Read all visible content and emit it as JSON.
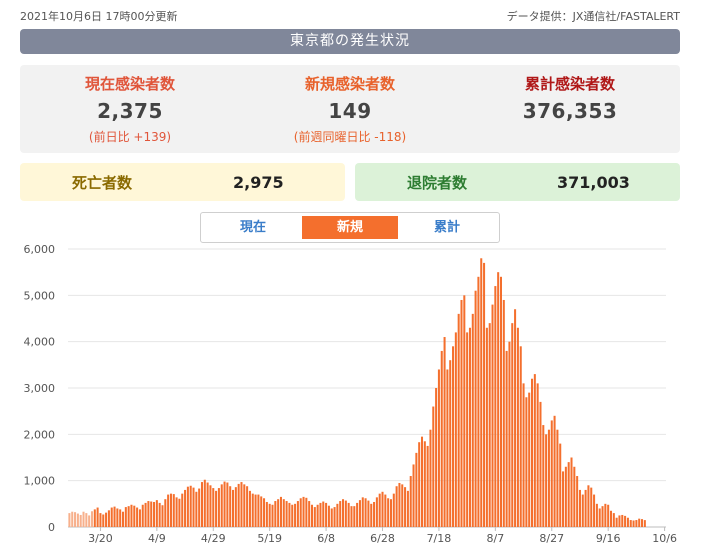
{
  "header": {
    "updated": "2021年10月6日 17時00分更新",
    "source": "データ提供：JX通信社/FASTALERT",
    "title": "東京都の発生状況"
  },
  "stats": {
    "current": {
      "label": "現在感染者数",
      "value": "2,375",
      "diff": "(前日比 +139)"
    },
    "new": {
      "label": "新規感染者数",
      "value": "149",
      "diff": "(前週同曜日比 -118)"
    },
    "total": {
      "label": "累計感染者数",
      "value": "376,353"
    }
  },
  "deaths": {
    "label": "死亡者数",
    "value": "2,975"
  },
  "recovered": {
    "label": "退院者数",
    "value": "371,003"
  },
  "tabs": [
    "現在",
    "新規",
    "累計"
  ],
  "active_tab": 1,
  "colors": {
    "bar": "#f46f2d",
    "bar_faded": "#f7b08c",
    "grid": "#e6e6e6"
  },
  "chart_data": {
    "type": "bar",
    "x_ticks": [
      "3/20",
      "4/9",
      "4/29",
      "5/19",
      "6/8",
      "6/28",
      "7/18",
      "8/7",
      "8/27",
      "9/16",
      "10/6"
    ],
    "y_ticks": [
      0,
      1000,
      2000,
      3000,
      4000,
      5000,
      6000
    ],
    "ylim": [
      0,
      6000
    ],
    "start_date": "2021-03-09",
    "end_date": "2021-10-06",
    "faded_until": "2021-03-17",
    "values": [
      300,
      330,
      320,
      290,
      260,
      330,
      300,
      250,
      340,
      380,
      420,
      300,
      270,
      310,
      360,
      420,
      440,
      400,
      380,
      330,
      430,
      450,
      480,
      460,
      420,
      380,
      480,
      520,
      560,
      550,
      540,
      580,
      520,
      470,
      600,
      700,
      720,
      710,
      640,
      610,
      720,
      800,
      870,
      890,
      850,
      760,
      830,
      970,
      1020,
      960,
      900,
      840,
      780,
      840,
      920,
      980,
      960,
      880,
      800,
      860,
      930,
      970,
      920,
      880,
      780,
      720,
      700,
      700,
      660,
      620,
      540,
      500,
      480,
      560,
      600,
      650,
      600,
      560,
      520,
      480,
      500,
      560,
      620,
      650,
      630,
      560,
      480,
      430,
      480,
      520,
      550,
      520,
      460,
      400,
      430,
      500,
      560,
      600,
      570,
      520,
      450,
      450,
      520,
      580,
      640,
      620,
      570,
      500,
      540,
      640,
      720,
      760,
      700,
      620,
      600,
      720,
      880,
      950,
      920,
      860,
      780,
      1100,
      1350,
      1600,
      1830,
      1950,
      1850,
      1750,
      2100,
      2600,
      3000,
      3400,
      3800,
      4100,
      3400,
      3600,
      3900,
      4200,
      4600,
      4900,
      5000,
      4200,
      4300,
      4600,
      5100,
      5400,
      5800,
      5700,
      4300,
      4400,
      4800,
      5200,
      5500,
      5400,
      4900,
      3800,
      4000,
      4400,
      4700,
      4300,
      3900,
      3100,
      2800,
      2900,
      3200,
      3300,
      3100,
      2700,
      2200,
      2000,
      2100,
      2300,
      2400,
      2100,
      1800,
      1200,
      1300,
      1400,
      1500,
      1300,
      1100,
      800,
      700,
      800,
      900,
      850,
      700,
      500,
      400,
      450,
      500,
      480,
      350,
      300,
      200,
      250,
      260,
      240,
      200,
      150,
      140,
      150,
      180,
      170,
      149
    ]
  }
}
